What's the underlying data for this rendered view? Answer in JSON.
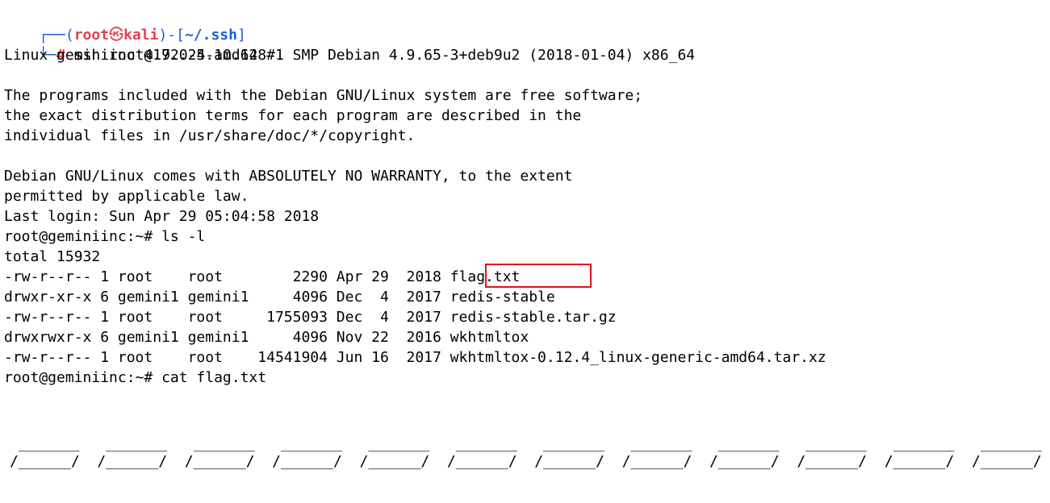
{
  "prompt": {
    "corner_top": "┌──",
    "open_paren": "(",
    "user": "root",
    "skull": "㉿",
    "host": "kali",
    "close_bracket": ")-[",
    "path": "~/.ssh",
    "end_bracket": "]",
    "corner_bottom": "└─",
    "hash": "#",
    "command": " ssh root@172.24.10.128"
  },
  "output": {
    "banner": "Linux geminiinc 4.9.0-5-amd64 #1 SMP Debian 4.9.65-3+deb9u2 (2018-01-04) x86_64",
    "license_1": "The programs included with the Debian GNU/Linux system are free software;",
    "license_2": "the exact distribution terms for each program are described in the",
    "license_3": "individual files in /usr/share/doc/*/copyright.",
    "warranty_1": "Debian GNU/Linux comes with ABSOLUTELY NO WARRANTY, to the extent",
    "warranty_2": "permitted by applicable law.",
    "last_login": "Last login: Sun Apr 29 05:04:58 2018",
    "cmd_ls": "root@geminiinc:~# ls -l",
    "total": "total 15932",
    "cmd_cat": "root@geminiinc:~# cat flag.txt"
  },
  "listing": [
    "-rw-r--r-- 1 root    root        2290 Apr 29  2018 flag.txt",
    "drwxr-xr-x 6 gemini1 gemini1     4096 Dec  4  2017 redis-stable",
    "-rw-r--r-- 1 root    root     1755093 Dec  4  2017 redis-stable.tar.gz",
    "drwxrwxr-x 6 gemini1 gemini1     4096 Nov 22  2016 wkhtmltox",
    "-rw-r--r-- 1 root    root    14541904 Jun 16  2017 wkhtmltox-0.12.4_linux-generic-amd64.tar.xz"
  ],
  "flag_art": {
    "row_1": " _______   _______   _______   _______   _______   _______   _______   _______   _______   _______   _______   _______",
    "row_2": "/______/  /______/  /______/  /______/  /______/  /______/  /______/  /______/  /______/  /______/  /______/  /______/"
  },
  "colors": {
    "prompt_blue": "#1a5fd4",
    "prompt_red": "#e2414f",
    "highlight_box": "#e0111b",
    "background": "#ffffff",
    "text": "#000000"
  }
}
